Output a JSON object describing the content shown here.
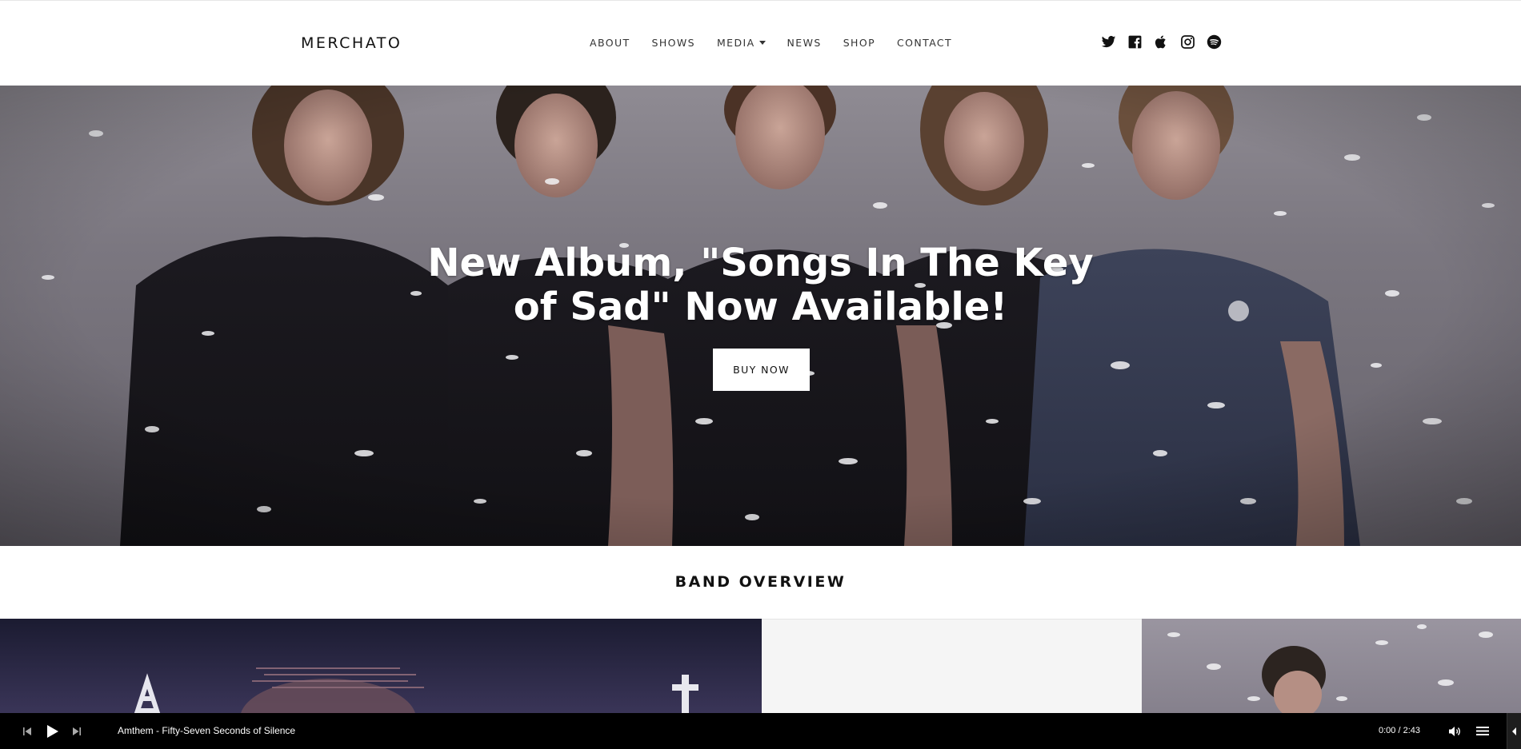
{
  "header": {
    "logo": "MERCHATO",
    "nav": [
      {
        "label": "ABOUT"
      },
      {
        "label": "SHOWS"
      },
      {
        "label": "MEDIA",
        "has_dropdown": true
      },
      {
        "label": "NEWS"
      },
      {
        "label": "SHOP"
      },
      {
        "label": "CONTACT"
      }
    ],
    "social_icons": [
      "twitter-icon",
      "facebook-icon",
      "apple-icon",
      "instagram-icon",
      "spotify-icon"
    ]
  },
  "hero": {
    "title_line1": "New Album, \"Songs In The Key",
    "title_line2": "of Sad\" Now Available!",
    "button_label": "BUY NOW"
  },
  "overview": {
    "title": "BAND OVERVIEW"
  },
  "player": {
    "track": "Amthem - Fifty-Seven Seconds of Silence",
    "time": "0:00 / 2:43",
    "controls": [
      "previous-icon",
      "play-icon",
      "next-icon",
      "volume-icon",
      "playlist-icon",
      "collapse-icon"
    ]
  },
  "colors": {
    "player_bg": "#000000",
    "button_bg": "#ffffff",
    "text_dark": "#111111"
  }
}
